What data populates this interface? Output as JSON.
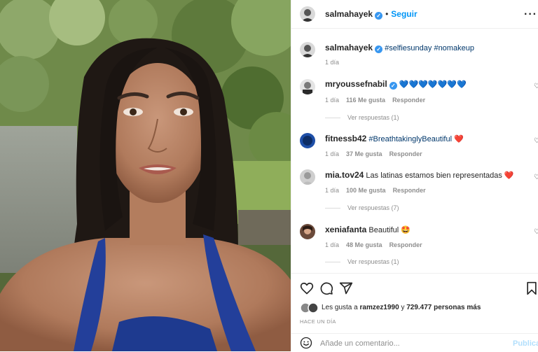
{
  "header": {
    "username": "salmahayek",
    "separator": "•",
    "follow_label": "Seguir",
    "more_label": "···"
  },
  "caption": {
    "username": "salmahayek",
    "text": "#selfiesunday #nomakeup",
    "time": "1 día"
  },
  "comments": [
    {
      "username": "mryoussefnabil",
      "verified": true,
      "text": "💙💙💙💙💙💙💙",
      "time": "1 día",
      "likes": "116 Me gusta",
      "reply": "Responder",
      "view_replies": "Ver respuestas (1)"
    },
    {
      "username": "fitnessb42",
      "verified": false,
      "text": "#BreathtakinglyBeautiful ❤️",
      "time": "1 día",
      "likes": "37 Me gusta",
      "reply": "Responder",
      "view_replies": ""
    },
    {
      "username": "mia.tov24",
      "verified": false,
      "text": "Las latinas estamos bien representadas ❤️",
      "time": "1 día",
      "likes": "100 Me gusta",
      "reply": "Responder",
      "view_replies": "Ver respuestas (7)"
    },
    {
      "username": "xeniafanta",
      "verified": false,
      "text": "Beautiful 🤩",
      "time": "1 día",
      "likes": "48 Me gusta",
      "reply": "Responder",
      "view_replies": "Ver respuestas (1)"
    }
  ],
  "likes_line": {
    "prefix": "Les gusta a",
    "user": "ramzez1990",
    "middle": "y",
    "count": "729.477 personas más"
  },
  "timestamp": "HACE UN DÍA",
  "add_comment": {
    "placeholder": "Añade un comentario...",
    "post_label": "Publicar"
  },
  "icons": {
    "like": "heart-icon",
    "comment": "comment-icon",
    "share": "share-icon",
    "save": "bookmark-icon",
    "emoji": "emoji-icon",
    "comment_like": "heart-outline-icon"
  },
  "colors": {
    "accent": "#0095f6",
    "verified": "#3897f0",
    "muted": "#8e8e8e"
  }
}
